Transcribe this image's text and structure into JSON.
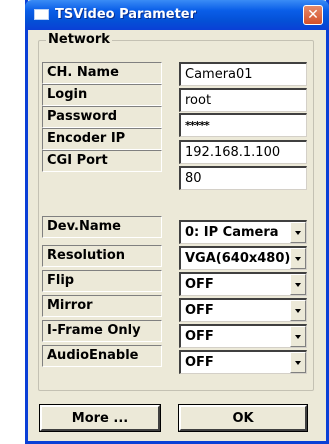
{
  "window": {
    "title": "TSVideo Parameter",
    "close_label": "✕"
  },
  "network": {
    "group_label": "Network",
    "fields": [
      {
        "label": "CH. Name",
        "value": "Camera01"
      },
      {
        "label": "Login",
        "value": "root"
      },
      {
        "label": "Password",
        "value": "*****"
      },
      {
        "label": "Encoder IP",
        "value": "192.168.1.100"
      },
      {
        "label": "CGI Port",
        "value": "80"
      }
    ],
    "selects": [
      {
        "label": "Dev.Name",
        "value": "0: IP Camera"
      },
      {
        "label": "Resolution",
        "value": "VGA(640x480)"
      },
      {
        "label": "Flip",
        "value": "OFF"
      },
      {
        "label": "Mirror",
        "value": "OFF"
      },
      {
        "label": "I-Frame Only",
        "value": "OFF"
      },
      {
        "label": "AudioEnable",
        "value": "OFF"
      }
    ]
  },
  "buttons": {
    "more_label": "More ...",
    "ok_label": "OK"
  },
  "colors": {
    "titlebar": "#0a5ee8",
    "dialog_bg": "#ece9d8",
    "close_button": "#d4502a"
  }
}
